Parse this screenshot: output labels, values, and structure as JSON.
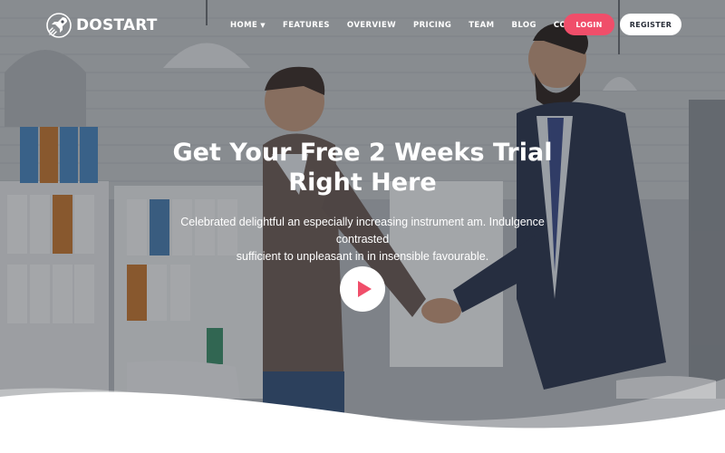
{
  "brand": {
    "name": "DOSTART",
    "icon": "rocket-icon"
  },
  "nav": {
    "items": [
      {
        "label": "HOME",
        "has_dropdown": true
      },
      {
        "label": "FEATURES"
      },
      {
        "label": "OVERVIEW"
      },
      {
        "label": "PRICING"
      },
      {
        "label": "TEAM"
      },
      {
        "label": "BLOG"
      },
      {
        "label": "CONTACT"
      }
    ],
    "login_label": "LOGIN",
    "register_label": "REGISTER"
  },
  "hero": {
    "title_line1": "Get Your Free 2 Weeks Trial",
    "title_line2": "Right Here",
    "subtitle_line1": "Celebrated delightful an especially increasing instrument am. Indulgence contrasted",
    "subtitle_line2": "sufficient to unpleasant in in insensible favourable.",
    "play_icon": "play-icon"
  },
  "colors": {
    "accent": "#f04e6a",
    "white": "#ffffff",
    "dark_text": "#2a2f3a"
  }
}
